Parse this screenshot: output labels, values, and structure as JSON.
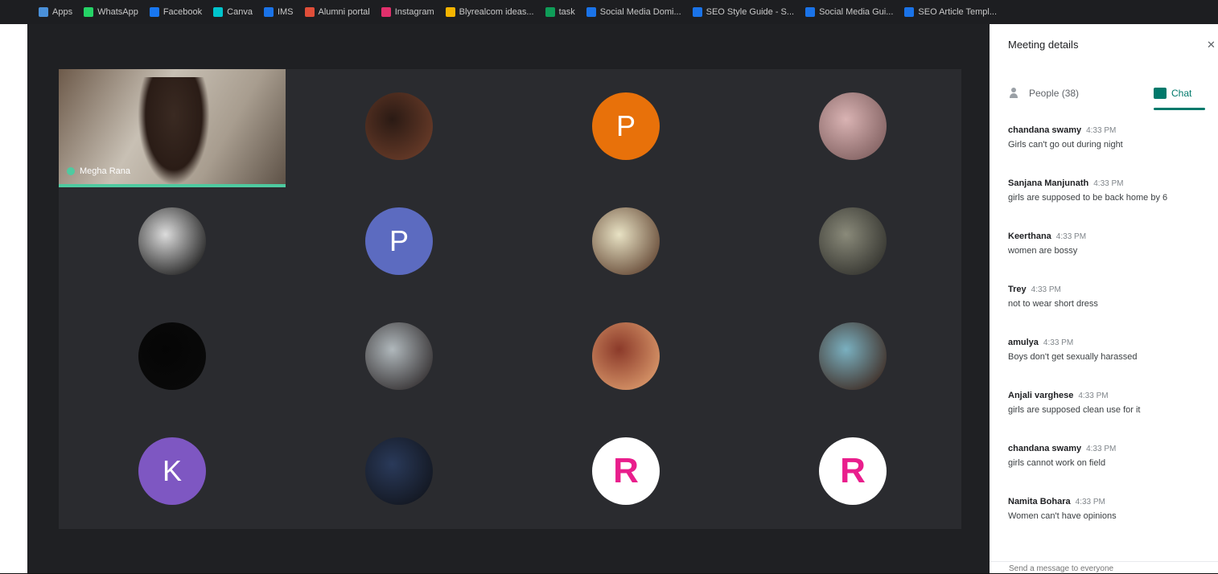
{
  "bookmarks": [
    {
      "label": "Apps",
      "color": "#4a90d9"
    },
    {
      "label": "WhatsApp",
      "color": "#25d366"
    },
    {
      "label": "Facebook",
      "color": "#1877f2"
    },
    {
      "label": "Canva",
      "color": "#00c4cc"
    },
    {
      "label": "IMS",
      "color": "#1a73e8"
    },
    {
      "label": "Alumni portal",
      "color": "#e04e39"
    },
    {
      "label": "Instagram",
      "color": "#e1306c"
    },
    {
      "label": "Blyrealcom ideas...",
      "color": "#f4b400"
    },
    {
      "label": "task",
      "color": "#0f9d58"
    },
    {
      "label": "Social Media Domi...",
      "color": "#1a73e8"
    },
    {
      "label": "SEO Style Guide - S...",
      "color": "#1a73e8"
    },
    {
      "label": "Social Media Gui...",
      "color": "#1a73e8"
    },
    {
      "label": "SEO Article Templ...",
      "color": "#1a73e8"
    }
  ],
  "participants": [
    {
      "type": "video",
      "name": "Megha Rana"
    },
    {
      "type": "photo",
      "colors": [
        "#2a1a14",
        "#6e3e2a"
      ]
    },
    {
      "type": "letter",
      "letter": "P",
      "color": "#e8710a"
    },
    {
      "type": "photo",
      "colors": [
        "#d9b3b3",
        "#7a5a5a"
      ]
    },
    {
      "type": "photo",
      "colors": [
        "#dcdcdc",
        "#111111"
      ]
    },
    {
      "type": "letter",
      "letter": "P",
      "color": "#5c6bc0"
    },
    {
      "type": "photo",
      "colors": [
        "#e8e2c4",
        "#5a3c2a"
      ]
    },
    {
      "type": "photo",
      "colors": [
        "#8a8a7a",
        "#2c2c28"
      ]
    },
    {
      "type": "photo",
      "colors": [
        "#050505",
        "#0a0a0a"
      ]
    },
    {
      "type": "photo",
      "colors": [
        "#b0b8bc",
        "#2a2526"
      ]
    },
    {
      "type": "photo",
      "colors": [
        "#8b3a2a",
        "#e0a070"
      ]
    },
    {
      "type": "photo",
      "colors": [
        "#7ab0c0",
        "#3a2218"
      ]
    },
    {
      "type": "letter",
      "letter": "K",
      "color": "#7e57c2"
    },
    {
      "type": "photo",
      "colors": [
        "#2a3a5a",
        "#10131a"
      ]
    },
    {
      "type": "logo",
      "letter": "R",
      "color": "#e91e8c"
    },
    {
      "type": "logo",
      "letter": "R",
      "color": "#e91e8c"
    }
  ],
  "panel": {
    "title": "Meeting details",
    "close_label": "✕",
    "tabs": {
      "people": "People (38)",
      "chat": "Chat"
    },
    "messages": [
      {
        "sender": "chandana swamy",
        "time": "4:33 PM",
        "text": "Girls can't go out during night"
      },
      {
        "sender": "Sanjana Manjunath",
        "time": "4:33 PM",
        "text": "girls are supposed to be back home by 6"
      },
      {
        "sender": "Keerthana",
        "time": "4:33 PM",
        "text": "women are bossy"
      },
      {
        "sender": "Trey",
        "time": "4:33 PM",
        "text": "not to wear short dress"
      },
      {
        "sender": "amulya",
        "time": "4:33 PM",
        "text": "Boys don't get sexually harassed"
      },
      {
        "sender": "Anjali varghese",
        "time": "4:33 PM",
        "text": "girls are supposed clean use for it"
      },
      {
        "sender": "chandana swamy",
        "time": "4:33 PM",
        "text": "girls cannot work on field"
      },
      {
        "sender": "Namita Bohara",
        "time": "4:33 PM",
        "text": "Women can't have opinions"
      }
    ],
    "composer_placeholder": "Send a message to everyone"
  }
}
